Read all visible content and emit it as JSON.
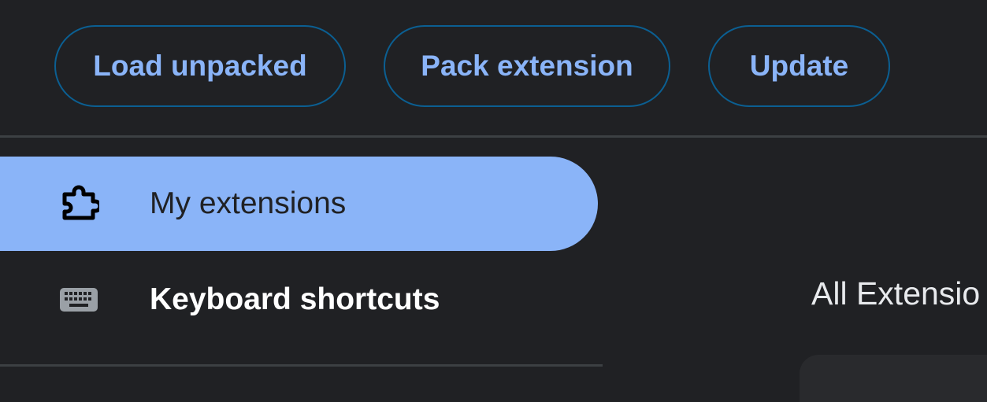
{
  "toolbar": {
    "load_unpacked_label": "Load unpacked",
    "pack_extension_label": "Pack extension",
    "update_label": "Update"
  },
  "sidebar": {
    "items": [
      {
        "label": "My extensions",
        "icon": "puzzle-piece-icon",
        "active": true
      },
      {
        "label": "Keyboard shortcuts",
        "icon": "keyboard-icon",
        "active": false
      }
    ]
  },
  "main": {
    "section_heading": "All Extensio"
  },
  "colors": {
    "background": "#202124",
    "accent": "#8ab4f8",
    "button_border": "#0b5f92",
    "divider": "#3c4043",
    "card": "#292a2d"
  }
}
